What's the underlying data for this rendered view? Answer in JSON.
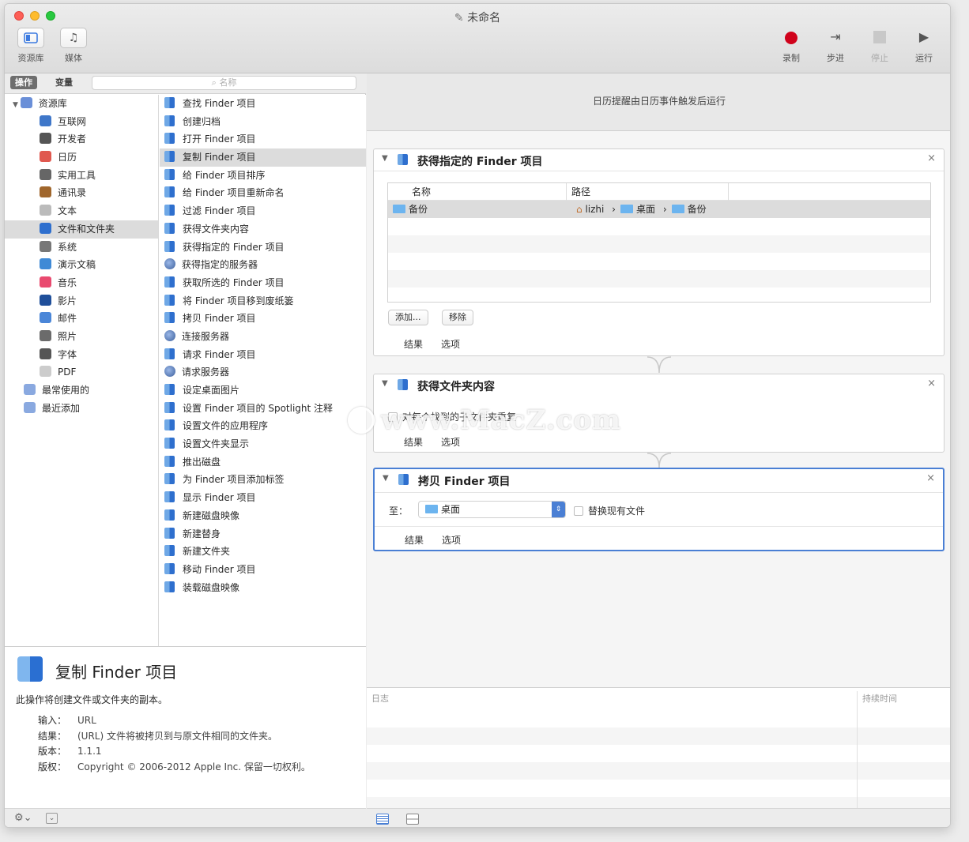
{
  "window": {
    "title": "未命名"
  },
  "toolbar": {
    "left": [
      {
        "label": "资源库",
        "icon": "library-icon"
      },
      {
        "label": "媒体",
        "icon": "media-icon"
      }
    ],
    "right": [
      {
        "label": "录制",
        "icon": "record-icon"
      },
      {
        "label": "步进",
        "icon": "step-icon"
      },
      {
        "label": "停止",
        "icon": "stop-icon"
      },
      {
        "label": "运行",
        "icon": "run-icon"
      }
    ]
  },
  "library": {
    "tab_actions": "操作",
    "tab_variables": "变量",
    "search_placeholder": "名称",
    "categories": [
      {
        "label": "资源库",
        "icon": "library-icon",
        "root": true
      },
      {
        "label": "互联网",
        "icon": "globe-icon"
      },
      {
        "label": "开发者",
        "icon": "tools-icon"
      },
      {
        "label": "日历",
        "icon": "calendar-icon"
      },
      {
        "label": "实用工具",
        "icon": "utilities-icon"
      },
      {
        "label": "通讯录",
        "icon": "contacts-icon"
      },
      {
        "label": "文本",
        "icon": "text-icon"
      },
      {
        "label": "文件和文件夹",
        "icon": "finder-icon",
        "selected": true
      },
      {
        "label": "系统",
        "icon": "system-icon"
      },
      {
        "label": "演示文稿",
        "icon": "presentation-icon"
      },
      {
        "label": "音乐",
        "icon": "music-icon"
      },
      {
        "label": "影片",
        "icon": "movie-icon"
      },
      {
        "label": "邮件",
        "icon": "mail-icon"
      },
      {
        "label": "照片",
        "icon": "photos-icon"
      },
      {
        "label": "字体",
        "icon": "font-icon"
      },
      {
        "label": "PDF",
        "icon": "pdf-icon"
      },
      {
        "label": "最常使用的",
        "icon": "smart-folder-icon",
        "top": true
      },
      {
        "label": "最近添加",
        "icon": "smart-folder-icon",
        "top": true
      }
    ],
    "actions": [
      {
        "label": "查找 Finder 项目",
        "icon": "finder-icon"
      },
      {
        "label": "创建归档",
        "icon": "finder-icon"
      },
      {
        "label": "打开 Finder 项目",
        "icon": "finder-icon"
      },
      {
        "label": "复制 Finder 项目",
        "icon": "finder-icon",
        "selected": true
      },
      {
        "label": "给 Finder 项目排序",
        "icon": "finder-icon"
      },
      {
        "label": "给 Finder 项目重新命名",
        "icon": "finder-icon"
      },
      {
        "label": "过滤 Finder 项目",
        "icon": "finder-icon"
      },
      {
        "label": "获得文件夹内容",
        "icon": "finder-icon"
      },
      {
        "label": "获得指定的 Finder 项目",
        "icon": "finder-icon"
      },
      {
        "label": "获得指定的服务器",
        "icon": "server-icon"
      },
      {
        "label": "获取所选的 Finder 项目",
        "icon": "finder-icon"
      },
      {
        "label": "将 Finder 项目移到废纸篓",
        "icon": "finder-icon"
      },
      {
        "label": "拷贝 Finder 项目",
        "icon": "finder-icon"
      },
      {
        "label": "连接服务器",
        "icon": "server-icon"
      },
      {
        "label": "请求 Finder 项目",
        "icon": "finder-icon"
      },
      {
        "label": "请求服务器",
        "icon": "server-icon"
      },
      {
        "label": "设定桌面图片",
        "icon": "finder-icon"
      },
      {
        "label": "设置 Finder 项目的 Spotlight 注释",
        "icon": "finder-icon"
      },
      {
        "label": "设置文件的应用程序",
        "icon": "finder-icon"
      },
      {
        "label": "设置文件夹显示",
        "icon": "finder-icon"
      },
      {
        "label": "推出磁盘",
        "icon": "finder-icon"
      },
      {
        "label": "为 Finder 项目添加标签",
        "icon": "finder-icon"
      },
      {
        "label": "显示 Finder 项目",
        "icon": "finder-icon"
      },
      {
        "label": "新建磁盘映像",
        "icon": "finder-icon"
      },
      {
        "label": "新建替身",
        "icon": "finder-icon"
      },
      {
        "label": "新建文件夹",
        "icon": "finder-icon"
      },
      {
        "label": "移动 Finder 项目",
        "icon": "finder-icon"
      },
      {
        "label": "装载磁盘映像",
        "icon": "finder-icon"
      }
    ]
  },
  "description": {
    "title": "复制 Finder 项目",
    "summary": "此操作将创建文件或文件夹的副本。",
    "fields": [
      {
        "key": "输入：",
        "value": "URL"
      },
      {
        "key": "结果：",
        "value": "(URL) 文件将被拷贝到与原文件相同的文件夹。"
      },
      {
        "key": "版本：",
        "value": "1.1.1"
      },
      {
        "key": "版权：",
        "value": "Copyright © 2006-2012 Apple Inc. 保留一切权利。"
      }
    ]
  },
  "workflow": {
    "banner": "日历提醒由日历事件触发后运行",
    "actions": [
      {
        "title": "获得指定的 Finder 项目",
        "columns": [
          "名称",
          "路径"
        ],
        "item_name": "备份",
        "path": [
          "lizhi",
          "桌面",
          "备份"
        ],
        "buttons": [
          "添加...",
          "移除"
        ],
        "footer": [
          "结果",
          "选项"
        ]
      },
      {
        "title": "获得文件夹内容",
        "checkbox": "对每个找到的子文件夹重复",
        "footer": [
          "结果",
          "选项"
        ]
      },
      {
        "title": "拷贝 Finder 项目",
        "to_label": "至：",
        "destination": "桌面",
        "checkbox": "替换现有文件",
        "footer": [
          "结果",
          "选项"
        ]
      }
    ]
  },
  "log": {
    "col_log": "日志",
    "col_duration": "持续时间"
  },
  "watermark": "www.MacZ.com",
  "colors": {
    "accent": "#4a7fd4",
    "record": "#d0021b",
    "selection": "#dcdcdc"
  }
}
